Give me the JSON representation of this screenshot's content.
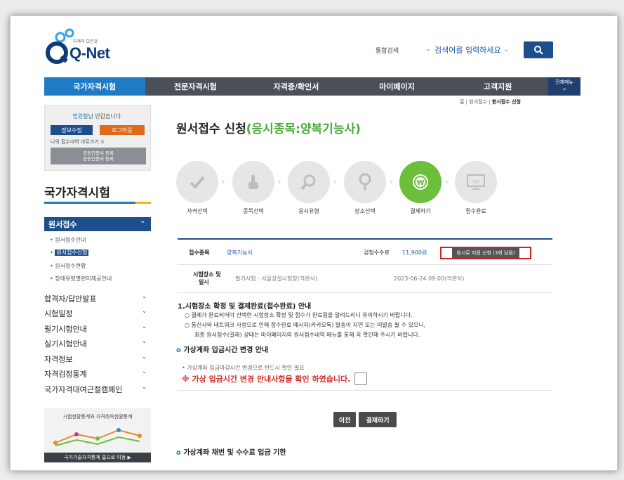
{
  "header": {
    "logo_tag": "자격의 모든것",
    "logo_text": "Q-Net",
    "search_scope": "통합검색",
    "search_placeholder": "검색어를 입력하세요"
  },
  "nav": {
    "items": [
      "국가자격시험",
      "전문자격시험",
      "자격증/확인서",
      "마이페이지",
      "고객지원"
    ],
    "all_menu": "전체메뉴"
  },
  "user": {
    "name": "범원철",
    "greeting_suffix": "님 반갑습니다.",
    "edit_label": "정보수정",
    "logout_label": "로그아웃",
    "shortcut_label": "나의 접수내역 바로가기",
    "cert_line1": "공동인증서 등록",
    "cert_line2": "공동인증서 등록"
  },
  "sidebar": {
    "title": "국가자격시험",
    "open_menu": "원서접수",
    "sub_items": [
      "원서접수안내",
      "원서접수신청",
      "원서접수현황",
      "장애유형별편의제공안내"
    ],
    "menus": [
      "합격자/답안발표",
      "시험일정",
      "필기시험안내",
      "실기시험안내",
      "자격정보",
      "자격검정통계",
      "국가자격대여근절캠페인"
    ],
    "promo_title": "시험현황통계와 자격취득현황통계",
    "promo_go": "국가기술자격통계 홈으로 이동"
  },
  "breadcrumb": {
    "home": "홈",
    "mid": "원서접수",
    "current": "원서접수 신청"
  },
  "page": {
    "title_prefix": "원서접수 신청",
    "title_highlight": "(응시종목:양복기능사)"
  },
  "steps": [
    "자격선택",
    "종목선택",
    "응시유형",
    "장소선택",
    "결제하기",
    "접수완료"
  ],
  "active_step": "결제하기",
  "info": {
    "item_label": "접수종목",
    "item_value": "양복기능사",
    "fee_label": "검정수수료",
    "fee_value": "11,900원",
    "support_btn": "응시료 지원 신청 (3회 남음)",
    "place_label_1": "시험장소 및",
    "place_label_2": "일시",
    "place_value": "필기시험 : 서울상설시험장(격관식)",
    "date_value": "2023-06-24 09:00(격관식)"
  },
  "notice": {
    "title": "1.시험장소 확정 및 결제완료(접수완료) 안내",
    "line1": "○ 결제가 완료되어야 선택한 시험장소 확정 및 접수가 완료됨을 알려드리니 유의하시기 바랍니다.",
    "line2": "○ 통신사와 네트워크 사정으로 인해 접수완료 메시지(카카오톡) 발송이 지연 또는 미발송 될 수 있으니,",
    "line3": "최종 원서접수(결제) 상태는 마이페이지의 원서접수내역 메뉴를 통해 꼭 확인해 주시기 바랍니다."
  },
  "virtual": {
    "title": "가상계좌 입금시간 변경 안내",
    "note": "• 가상계좌 입금마감시간 변경으로 반드시 확인 필요",
    "warn": "※ 가상 입금시간 변경 안내사항을 확인 하였습니다."
  },
  "buttons": {
    "prev": "이전",
    "pay": "결제하기"
  },
  "bottom_section": "가상계좌 채번 및 수수료 입금 기한",
  "colors": {
    "brand": "#1f4e8c",
    "accent_green": "#6bbf3b",
    "nav_active": "#1e7bc4",
    "warn_red": "#d3302a"
  }
}
